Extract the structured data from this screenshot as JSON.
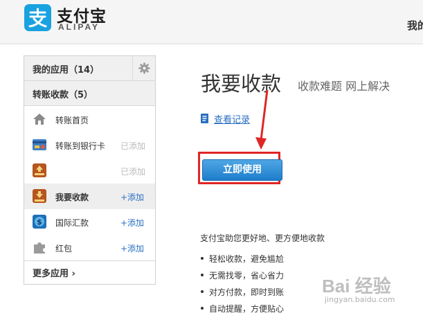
{
  "header": {
    "logo_cn": "支付宝",
    "logo_en": "ALIPAY",
    "nav_text": "我的"
  },
  "sidebar": {
    "my_apps": "我的应用（14）",
    "transfer_group": "转账收款（5）",
    "items": [
      {
        "label": "转账首页",
        "action": "",
        "icon": "home-icon",
        "active": false
      },
      {
        "label": "转账到银行卡",
        "action": "已添加",
        "icon": "bank-card-icon",
        "active": false
      },
      {
        "label": "",
        "action": "已添加",
        "icon": "upload-tray-icon",
        "active": false
      },
      {
        "label": "我要收款",
        "action": "+添加",
        "icon": "download-tray-icon",
        "active": true
      },
      {
        "label": "国际汇款",
        "action": "+添加",
        "icon": "dollar-globe-icon",
        "active": false
      },
      {
        "label": "红包",
        "action": "+添加",
        "icon": "puzzle-icon",
        "active": false
      }
    ],
    "more_apps": "更多应用"
  },
  "main": {
    "title": "我要收款",
    "subtitle": "收款难题 网上解决",
    "record_link": "查看记录",
    "use_button": "立即使用",
    "intro": "支付宝助您更好地、更方便地收款",
    "features": [
      "轻松收款，避免尴尬",
      "无需找零，省心省力",
      "对方付款，即时到账",
      "自动提醒，方便贴心"
    ]
  },
  "watermark": {
    "main": "Bai 经验",
    "sub": "jingyan.baidu.com"
  },
  "colors": {
    "alipay_blue": "#1aa2e0",
    "link_blue": "#2a6fc0",
    "button_blue": "#1e7dcb",
    "highlight_red": "#e02525"
  }
}
